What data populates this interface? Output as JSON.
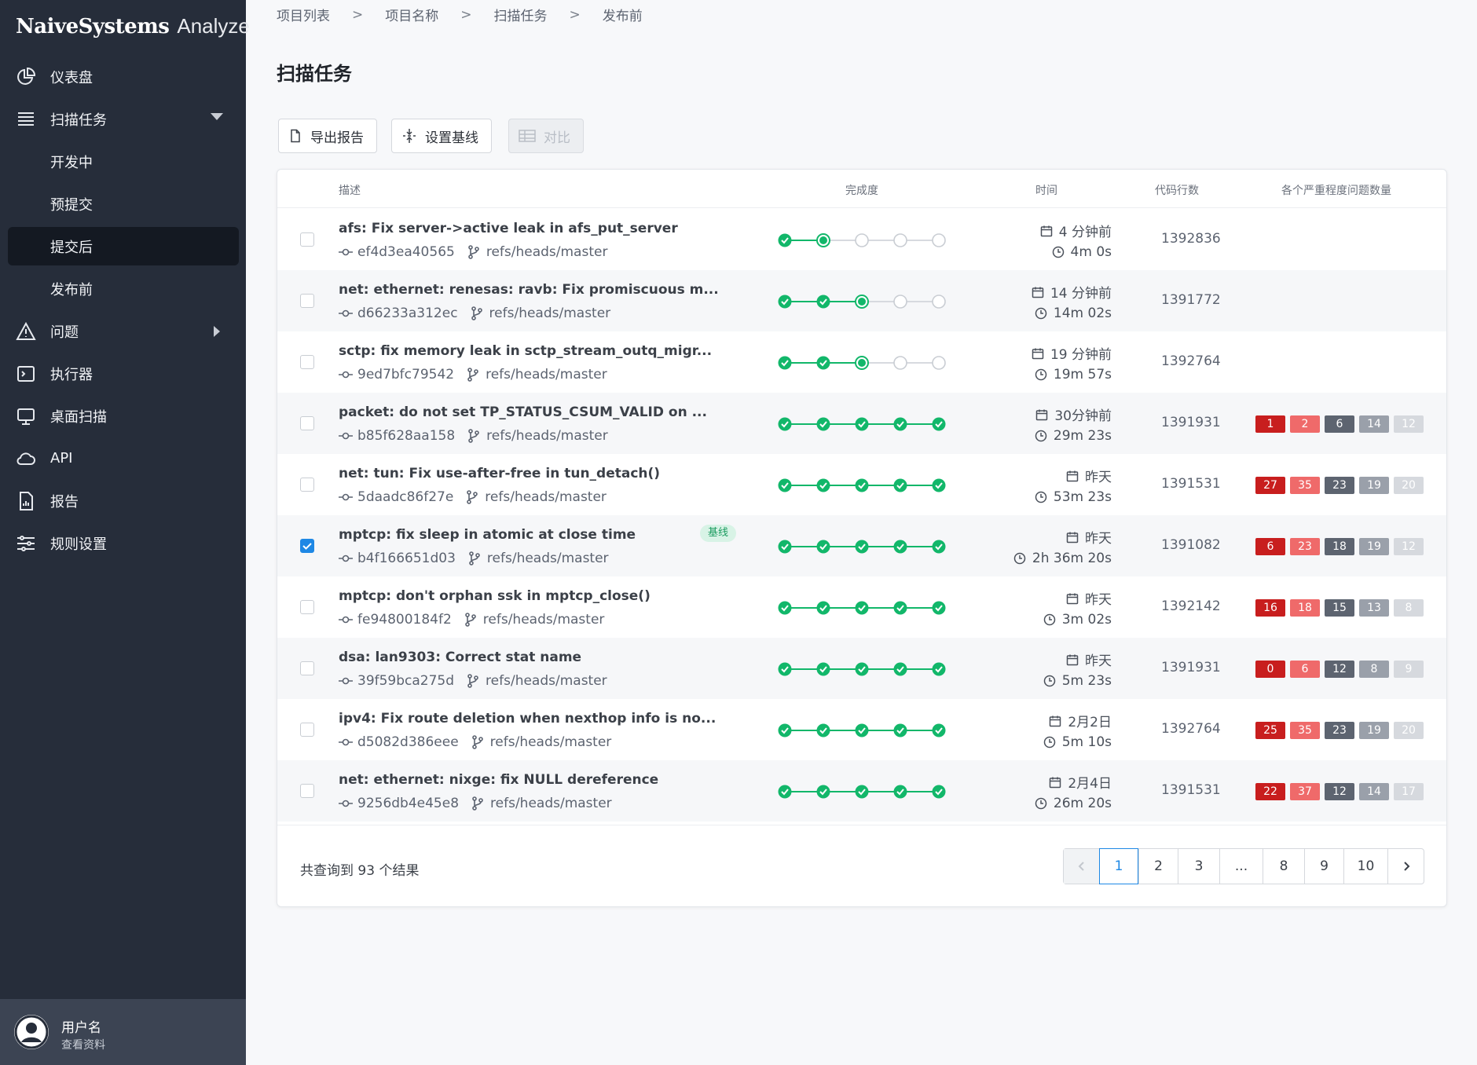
{
  "brand": {
    "name": "NaiveSystems",
    "product": "Analyze"
  },
  "sidebar": {
    "items": [
      {
        "label": "仪表盘",
        "icon": "dashboard-icon"
      },
      {
        "label": "扫描任务",
        "icon": "list-icon"
      },
      {
        "label": "开发中"
      },
      {
        "label": "预提交"
      },
      {
        "label": "提交后"
      },
      {
        "label": "发布前"
      },
      {
        "label": "问题",
        "icon": "warning-icon"
      },
      {
        "label": "执行器",
        "icon": "terminal-icon"
      },
      {
        "label": "桌面扫描",
        "icon": "desktop-icon"
      },
      {
        "label": "API",
        "icon": "cloud-icon"
      },
      {
        "label": "报告",
        "icon": "report-icon"
      },
      {
        "label": "规则设置",
        "icon": "sliders-icon"
      }
    ],
    "user": {
      "name": "用户名",
      "profile": "查看资料"
    }
  },
  "breadcrumb": [
    "项目列表",
    "项目名称",
    "扫描任务",
    "发布前"
  ],
  "breadcrumb_sep": ">",
  "page_title": "扫描任务",
  "toolbar": {
    "export": "导出报告",
    "baseline": "设置基线",
    "compare": "对比"
  },
  "table": {
    "headers": {
      "desc": "描述",
      "progress": "完成度",
      "time": "时间",
      "loc": "代码行数",
      "severity": "各个严重程度问题数量"
    },
    "rows": [
      {
        "title": "afs: Fix server->active leak in afs_put_server",
        "commit": "ef4d3ea40565",
        "branch": "refs/heads/master",
        "progress": 2,
        "when": "4 分钟前",
        "duration": "4m 0s",
        "loc": "1392836",
        "sev": [],
        "checked": false,
        "baseline": ""
      },
      {
        "title": "net: ethernet: renesas: ravb: Fix promiscuous m...",
        "commit": "d66233a312ec",
        "branch": "refs/heads/master",
        "progress": 3,
        "when": "14 分钟前",
        "duration": "14m 02s",
        "loc": "1391772",
        "sev": [],
        "checked": false,
        "baseline": ""
      },
      {
        "title": "sctp: fix memory leak in sctp_stream_outq_migr...",
        "commit": "9ed7bfc79542",
        "branch": "refs/heads/master",
        "progress": 3,
        "when": "19 分钟前",
        "duration": "19m 57s",
        "loc": "1392764",
        "sev": [],
        "checked": false,
        "baseline": ""
      },
      {
        "title": "packet: do not set TP_STATUS_CSUM_VALID on ...",
        "commit": "b85f628aa158",
        "branch": "refs/heads/master",
        "progress": 5,
        "when": "30分钟前",
        "duration": "29m 23s",
        "loc": "1391931",
        "sev": [
          "1",
          "2",
          "6",
          "14",
          "12"
        ],
        "checked": false,
        "baseline": ""
      },
      {
        "title": "net: tun: Fix use-after-free in tun_detach()",
        "commit": "5daadc86f27e",
        "branch": "refs/heads/master",
        "progress": 5,
        "when": "昨天",
        "duration": "53m 23s",
        "loc": "1391531",
        "sev": [
          "27",
          "35",
          "23",
          "19",
          "20"
        ],
        "checked": false,
        "baseline": ""
      },
      {
        "title": "mptcp: fix sleep in atomic at close time",
        "commit": "b4f166651d03",
        "branch": "refs/heads/master",
        "progress": 5,
        "when": "昨天",
        "duration": "2h 36m 20s",
        "loc": "1391082",
        "sev": [
          "6",
          "23",
          "18",
          "19",
          "12"
        ],
        "checked": true,
        "baseline": "基线"
      },
      {
        "title": "mptcp: don't orphan ssk in mptcp_close()",
        "commit": "fe94800184f2",
        "branch": "refs/heads/master",
        "progress": 5,
        "when": "昨天",
        "duration": "3m 02s",
        "loc": "1392142",
        "sev": [
          "16",
          "18",
          "15",
          "13",
          "8"
        ],
        "checked": false,
        "baseline": ""
      },
      {
        "title": "dsa: lan9303: Correct stat name",
        "commit": "39f59bca275d",
        "branch": "refs/heads/master",
        "progress": 5,
        "when": "昨天",
        "duration": "5m 23s",
        "loc": "1391931",
        "sev": [
          "0",
          "6",
          "12",
          "8",
          "9"
        ],
        "checked": false,
        "baseline": ""
      },
      {
        "title": "ipv4: Fix route deletion when nexthop info is no...",
        "commit": "d5082d386eee",
        "branch": "refs/heads/master",
        "progress": 5,
        "when": "2月2日",
        "duration": "5m 10s",
        "loc": "1392764",
        "sev": [
          "25",
          "35",
          "23",
          "19",
          "20"
        ],
        "checked": false,
        "baseline": ""
      },
      {
        "title": "net: ethernet: nixge: fix NULL dereference",
        "commit": "9256db4e45e8",
        "branch": "refs/heads/master",
        "progress": 5,
        "when": "2月4日",
        "duration": "26m 20s",
        "loc": "1391531",
        "sev": [
          "22",
          "37",
          "12",
          "14",
          "17"
        ],
        "checked": false,
        "baseline": ""
      }
    ]
  },
  "footer": {
    "total": "共查询到 93 个结果"
  },
  "pagination": {
    "pages": [
      "1",
      "2",
      "3",
      "...",
      "8",
      "9",
      "10"
    ],
    "current": "1"
  },
  "colors": {
    "accent": "#1e88e5",
    "success": "#12b76a",
    "sidebar": "#262d3a",
    "sev_critical": "#c81e1e",
    "sev_high": "#ef6a6a",
    "sev_medium": "#5d6470",
    "sev_low": "#9aa0aa",
    "sev_info": "#d6d9de"
  }
}
